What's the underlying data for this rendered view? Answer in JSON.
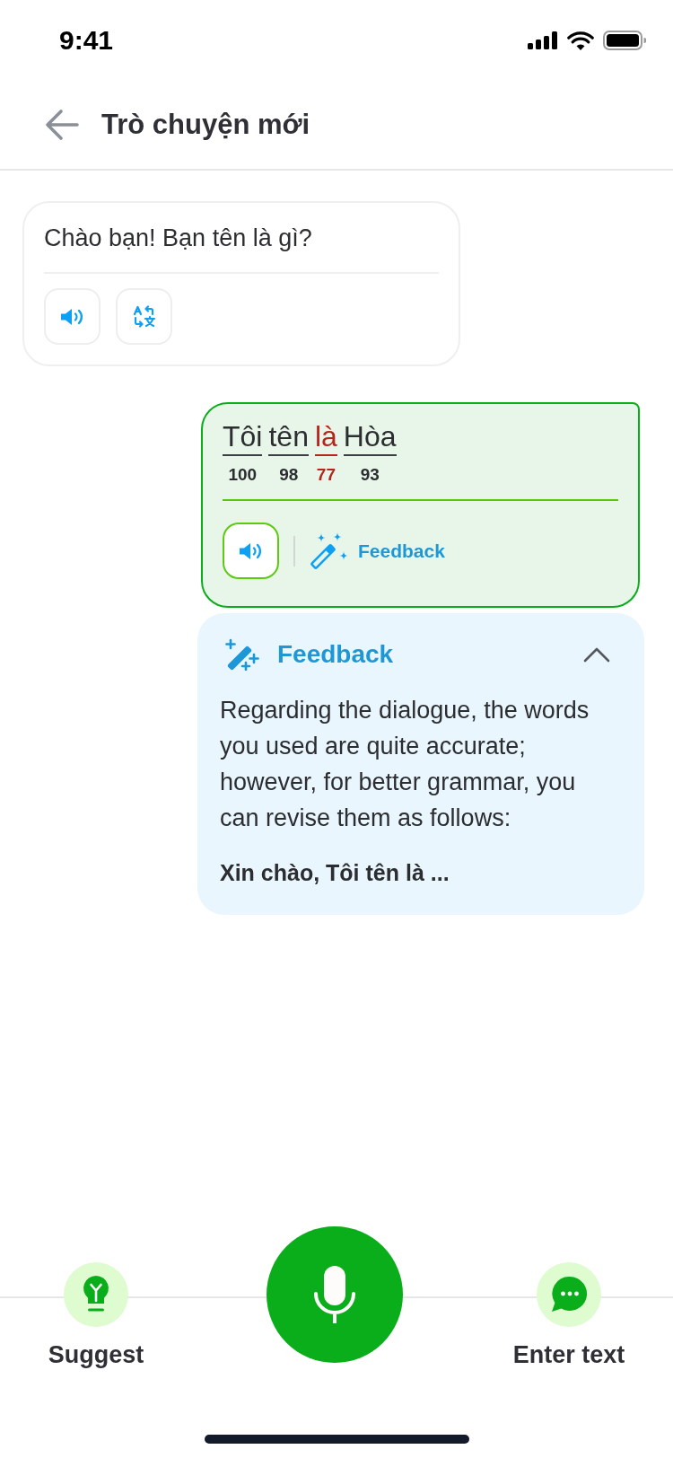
{
  "status_bar": {
    "time": "9:41"
  },
  "header": {
    "title": "Trò chuyện mới"
  },
  "messages": [
    {
      "kind": "bot",
      "text": "Chào bạn! Bạn tên là gì?",
      "actions": [
        {
          "kind": "speak"
        },
        {
          "kind": "translate"
        }
      ]
    },
    {
      "kind": "user",
      "words": [
        {
          "text": "Tôi",
          "score": "100",
          "mispronounced": false
        },
        {
          "text": "tên",
          "score": "98",
          "mispronounced": false
        },
        {
          "text": "là",
          "score": "77",
          "mispronounced": true
        },
        {
          "text": "Hòa",
          "score": "93",
          "mispronounced": false
        }
      ],
      "actions": [
        {
          "kind": "speak"
        },
        {
          "kind": "feedback",
          "label": "Feedback"
        }
      ]
    }
  ],
  "feedback_panel": {
    "title": "Feedback",
    "expanded": true,
    "body": "Regarding the dialogue, the words you used are quite accurate; however, for better grammar, you can revise them as follows:",
    "suggestion": "Xin chào, Tôi tên là ..."
  },
  "bottom_bar": {
    "actions": [
      {
        "kind": "suggest",
        "label": "Suggest"
      },
      {
        "kind": "record"
      },
      {
        "kind": "enter_text",
        "label": "Enter text"
      }
    ]
  }
}
